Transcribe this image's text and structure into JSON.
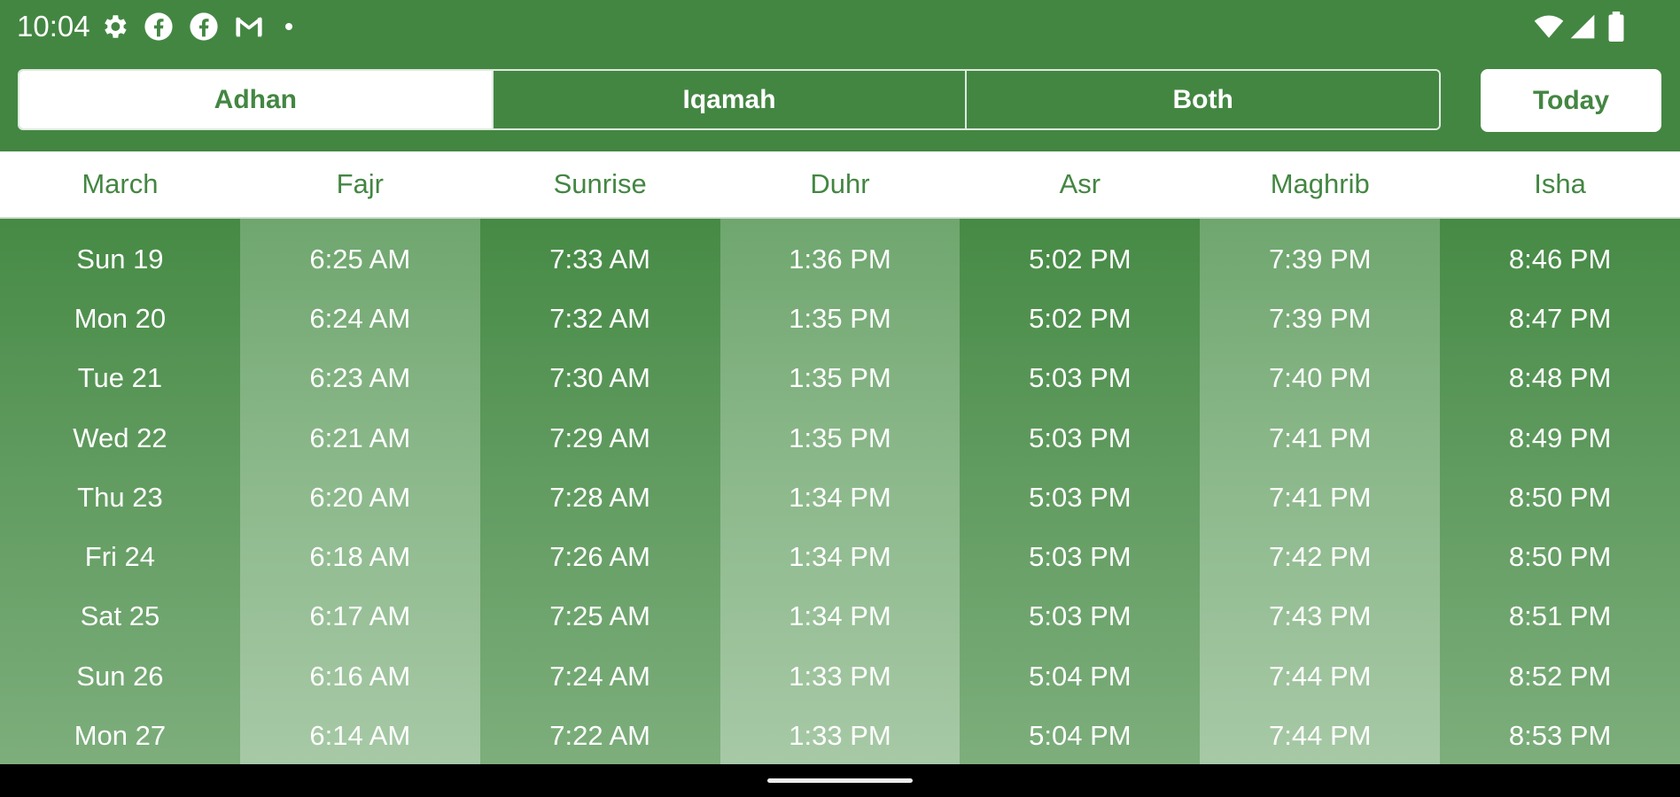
{
  "status_bar": {
    "time": "10:04",
    "left_icons": [
      "settings-icon",
      "facebook-icon",
      "facebook-icon",
      "gmail-icon",
      "dot-icon"
    ],
    "right_icons": [
      "wifi-icon",
      "cell-signal-icon",
      "battery-icon"
    ]
  },
  "toolbar": {
    "segments": [
      "Adhan",
      "Iqamah",
      "Both"
    ],
    "selected_segment": "Adhan",
    "today_label": "Today"
  },
  "table": {
    "headers": [
      "March",
      "Fajr",
      "Sunrise",
      "Duhr",
      "Asr",
      "Maghrib",
      "Isha"
    ],
    "columns": [
      [
        "Sun 19",
        "Mon 20",
        "Tue 21",
        "Wed 22",
        "Thu 23",
        "Fri 24",
        "Sat 25",
        "Sun 26",
        "Mon 27"
      ],
      [
        "6:25 AM",
        "6:24 AM",
        "6:23 AM",
        "6:21 AM",
        "6:20 AM",
        "6:18 AM",
        "6:17 AM",
        "6:16 AM",
        "6:14 AM"
      ],
      [
        "7:33 AM",
        "7:32 AM",
        "7:30 AM",
        "7:29 AM",
        "7:28 AM",
        "7:26 AM",
        "7:25 AM",
        "7:24 AM",
        "7:22 AM"
      ],
      [
        "1:36 PM",
        "1:35 PM",
        "1:35 PM",
        "1:35 PM",
        "1:34 PM",
        "1:34 PM",
        "1:34 PM",
        "1:33 PM",
        "1:33 PM"
      ],
      [
        "5:02 PM",
        "5:02 PM",
        "5:03 PM",
        "5:03 PM",
        "5:03 PM",
        "5:03 PM",
        "5:03 PM",
        "5:04 PM",
        "5:04 PM"
      ],
      [
        "7:39 PM",
        "7:39 PM",
        "7:40 PM",
        "7:41 PM",
        "7:41 PM",
        "7:42 PM",
        "7:43 PM",
        "7:44 PM",
        "7:44 PM"
      ],
      [
        "8:46 PM",
        "8:47 PM",
        "8:48 PM",
        "8:49 PM",
        "8:50 PM",
        "8:50 PM",
        "8:51 PM",
        "8:52 PM",
        "8:53 PM"
      ]
    ]
  },
  "colors": {
    "primary_green": "#438642",
    "on_primary": "#ffffff"
  }
}
